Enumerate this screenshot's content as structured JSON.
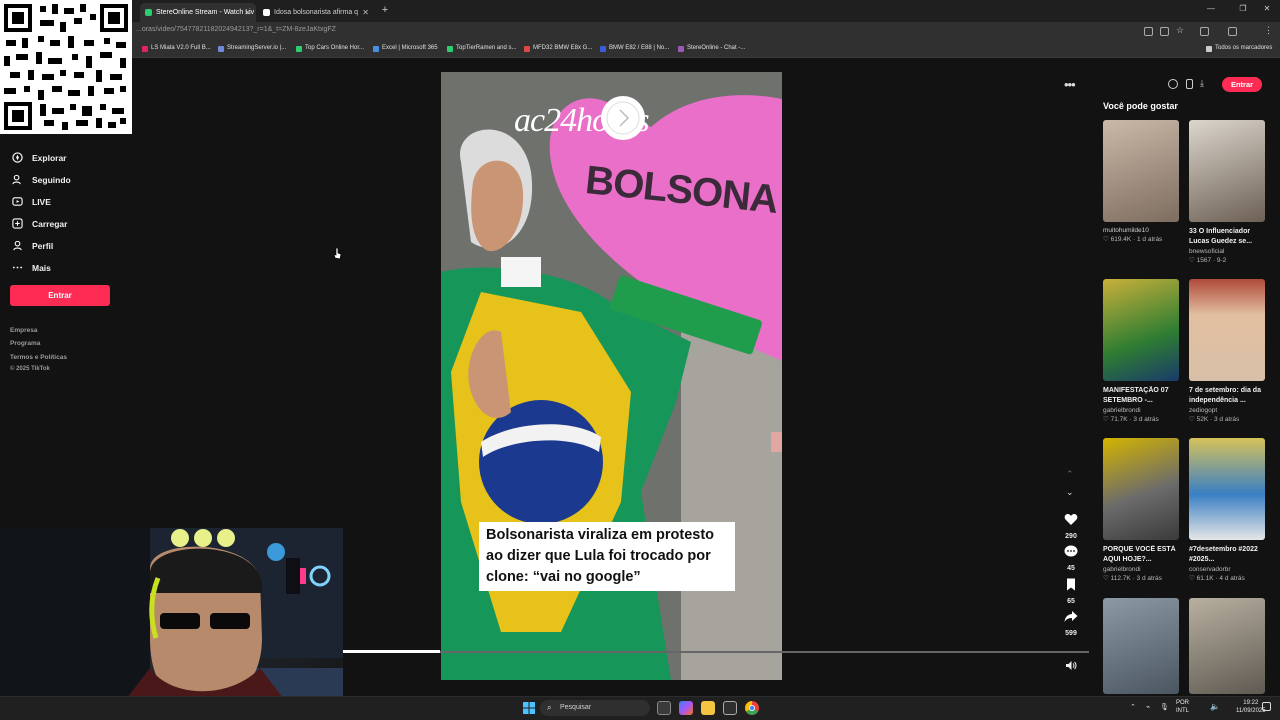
{
  "browser": {
    "tabs": [
      {
        "label": "StereOnline Stream - Watch Liv",
        "favicon_color": "#2ecc71"
      },
      {
        "label": "Idosa bolsonarista afirma q",
        "favicon_color": "#ffffff"
      }
    ],
    "url": "...oras/video/7547782118202494213?_r=1&_t=ZM-8zeJaKtxgFZ",
    "bookmarks": [
      {
        "label": "LS Miata V2.0 Full B...",
        "color": "#e0245e"
      },
      {
        "label": "StreamingServer.io |...",
        "color": "#7289da"
      },
      {
        "label": "Top Cars Online Hor...",
        "color": "#2ecc71"
      },
      {
        "label": "Excel | Microsoft 365",
        "color": "#4a90e2"
      },
      {
        "label": "TopTierRamen and s...",
        "color": "#2ecc71"
      },
      {
        "label": "MFD32 BMW E8x G...",
        "color": "#e04848"
      },
      {
        "label": "BMW E82 / E88 | No...",
        "color": "#3b5bdb"
      },
      {
        "label": "StereOnline - Chat -...",
        "color": "#9b59b6"
      }
    ],
    "all_bookmarks": "Todos os marcadores"
  },
  "sidebar": {
    "items": [
      {
        "label": "Explorar",
        "icon": "compass-icon"
      },
      {
        "label": "Seguindo",
        "icon": "user-follow-icon"
      },
      {
        "label": "LIVE",
        "icon": "live-icon"
      },
      {
        "label": "Carregar",
        "icon": "upload-icon"
      },
      {
        "label": "Perfil",
        "icon": "profile-icon"
      },
      {
        "label": "Mais",
        "icon": "more-icon"
      }
    ],
    "login_button": "Entrar",
    "footer": [
      "Empresa",
      "Programa",
      "Termos e Políticas",
      "© 2025 TikTok"
    ]
  },
  "video": {
    "logo": "ac24horas",
    "caption": "Bolsonarista viraliza em protesto ao dizer que Lula foi trocado por clone: “vai no google”",
    "sign_text": "BOLSONA",
    "progress": 0.13,
    "actions": {
      "likes": "290",
      "comments": "45",
      "saves": "65",
      "shares": "599"
    }
  },
  "header_right": {
    "entrar": "Entrar"
  },
  "suggestions": {
    "title": "Você pode gostar",
    "cards": [
      {
        "title": "",
        "user": "muitohumilde10",
        "meta": "♡ 619.4K · 1 d atrás",
        "colors": [
          "#c9b8a8",
          "#8a7a6d"
        ]
      },
      {
        "title": "33 O Influenciador Lucas Guedez se...",
        "user": "bnewsoficial",
        "meta": "♡ 1567 · 9-2",
        "colors": [
          "#d9d3c9",
          "#6f6257"
        ]
      },
      {
        "title": "MANIFESTAÇÃO 07 SETEMBRO -...",
        "user": "gabrielbrondi",
        "meta": "♡ 71.7K · 3 d atrás",
        "colors": [
          "#2e7d32",
          "#c8a400"
        ]
      },
      {
        "title": "7 de setembro: dia da independência ...",
        "user": "zediogopt",
        "meta": "♡ 52K · 3 d atrás",
        "colors": [
          "#c85a3a",
          "#e8c2a0"
        ]
      },
      {
        "title": "PORQUE VOCÊ ESTÁ AQUI HOJE?...",
        "user": "gabrielbrondi",
        "meta": "♡ 112.7K · 3 d atrás",
        "colors": [
          "#d4b400",
          "#4a4a4a"
        ]
      },
      {
        "title": "#7desetembro #2022 #2025...",
        "user": "conservadorbr",
        "meta": "♡ 61.1K · 4 d atrás",
        "colors": [
          "#2e6da4",
          "#d6c25a"
        ]
      },
      {
        "title": "",
        "user": "",
        "meta": "",
        "colors": [
          "#8c9aa6",
          "#4a5560"
        ]
      },
      {
        "title": "",
        "user": "",
        "meta": "",
        "colors": [
          "#b8b0a0",
          "#5f5a52"
        ]
      }
    ]
  },
  "taskbar": {
    "search": "Pesquisar",
    "lang": [
      "POR",
      "INTL"
    ],
    "time": "19:22",
    "date": "11/09/2025"
  }
}
